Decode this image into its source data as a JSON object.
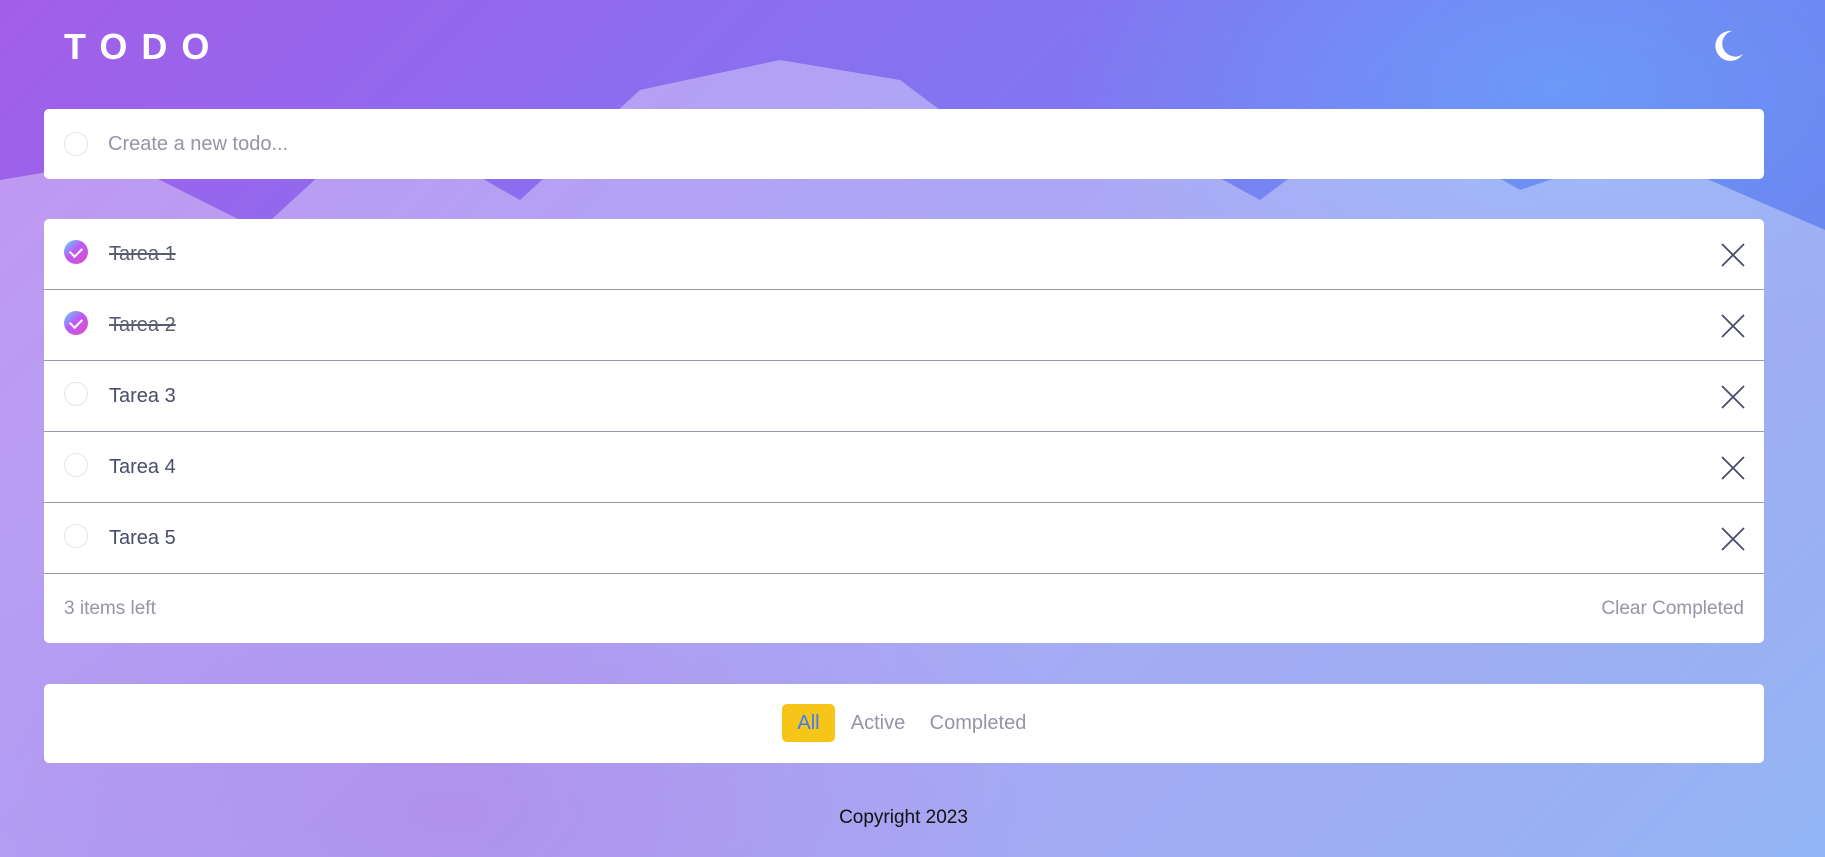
{
  "app": {
    "title": "TODO",
    "theme_toggle_icon": "moon-icon"
  },
  "new_todo": {
    "placeholder": "Create a new todo...",
    "value": ""
  },
  "todos": [
    {
      "text": "Tarea 1",
      "completed": true
    },
    {
      "text": "Tarea 2",
      "completed": true
    },
    {
      "text": "Tarea 3",
      "completed": false
    },
    {
      "text": "Tarea 4",
      "completed": false
    },
    {
      "text": "Tarea 5",
      "completed": false
    }
  ],
  "list_footer": {
    "items_left": "3 items left",
    "clear_completed_label": "Clear Completed"
  },
  "filters": {
    "all": "All",
    "active": "Active",
    "completed": "Completed",
    "selected": "All"
  },
  "footer": {
    "copyright": "Copyright 2023"
  },
  "colors": {
    "accent": "#f5c518",
    "active_filter_text": "#3a7bfd",
    "check_gradient_start": "#55ddff",
    "check_gradient_end": "#c058f3"
  }
}
